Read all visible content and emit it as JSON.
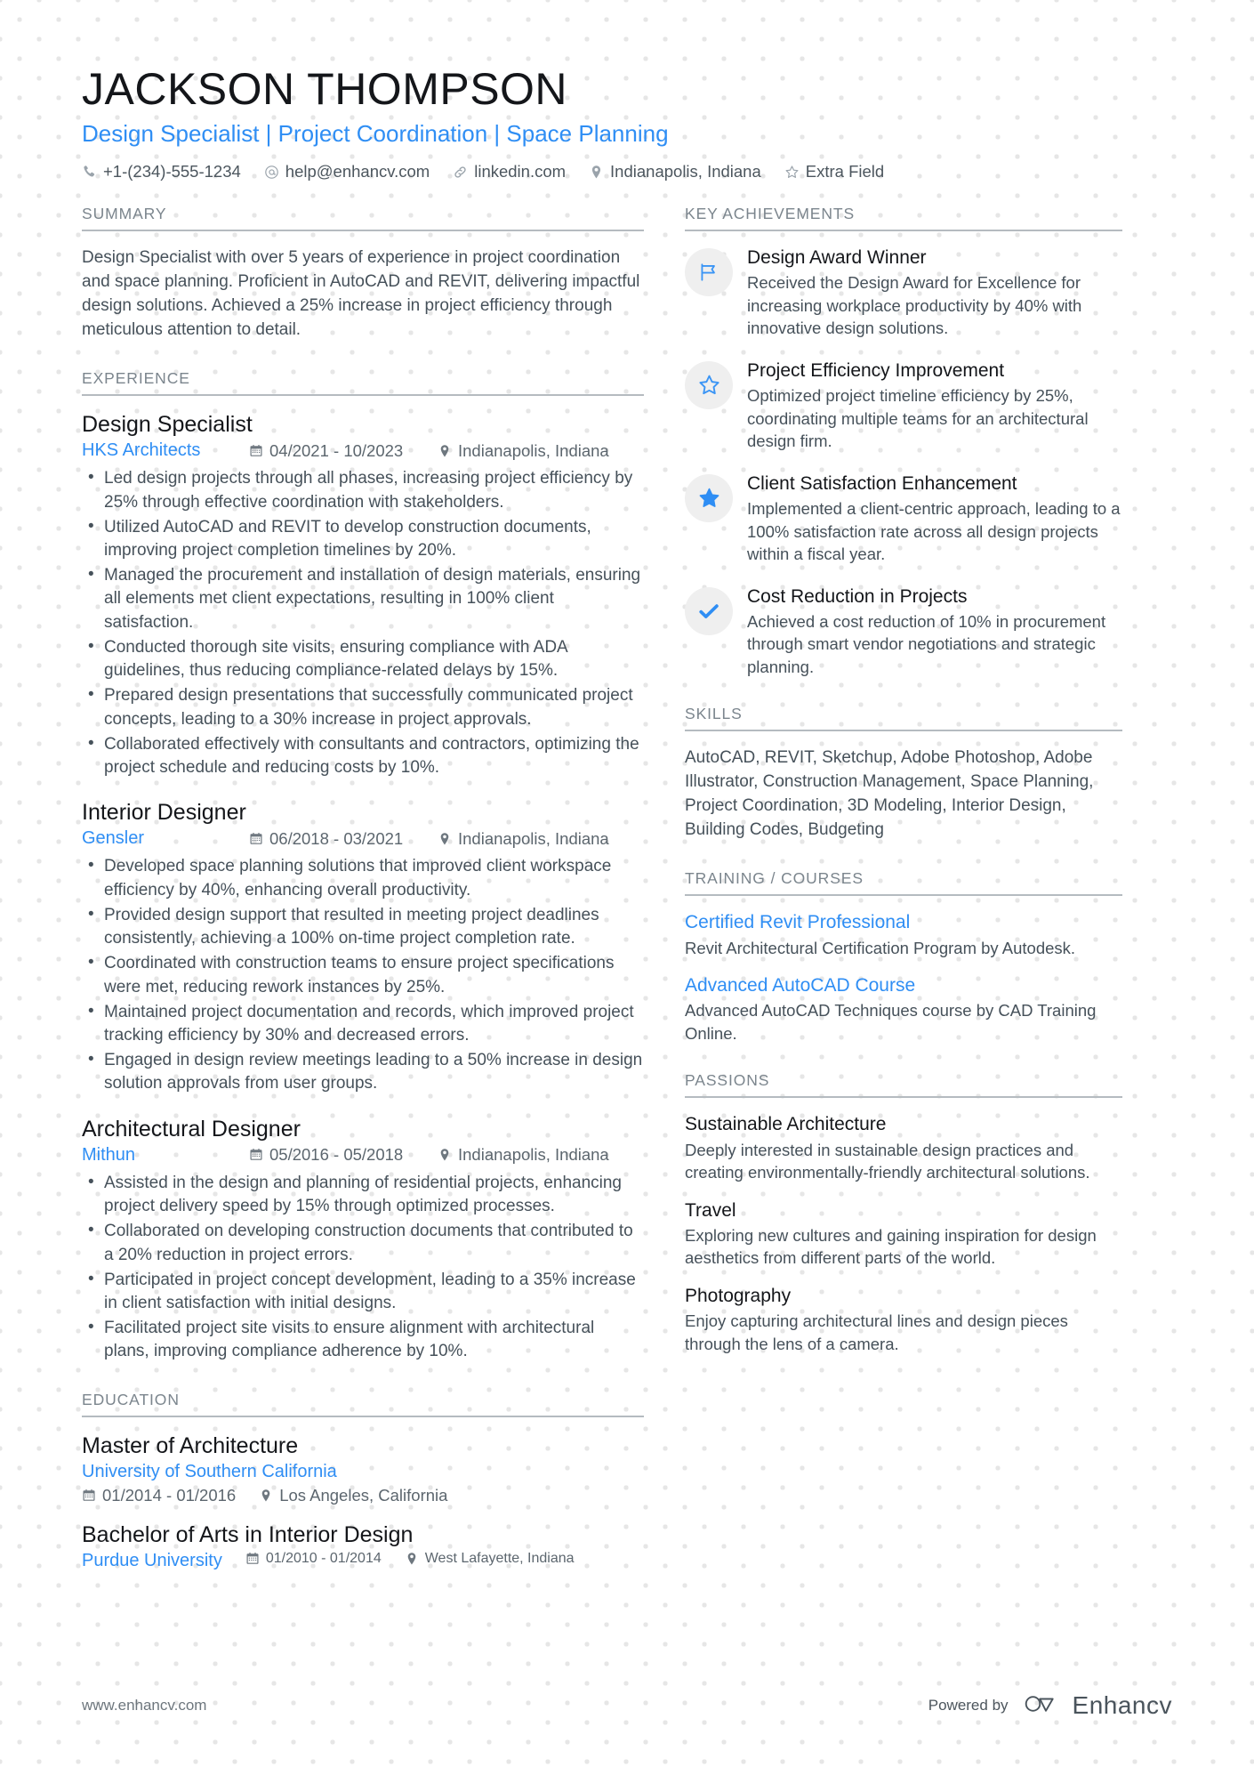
{
  "header": {
    "name": "JACKSON THOMPSON",
    "headline": "Design Specialist | Project Coordination | Space Planning",
    "contacts": [
      {
        "icon": "phone-icon",
        "text": "+1-(234)-555-1234"
      },
      {
        "icon": "email-icon",
        "text": "help@enhancv.com"
      },
      {
        "icon": "link-icon",
        "text": "linkedin.com"
      },
      {
        "icon": "location-icon",
        "text": "Indianapolis, Indiana"
      },
      {
        "icon": "star-icon",
        "text": "Extra Field"
      }
    ]
  },
  "sections": {
    "summary_heading": "SUMMARY",
    "experience_heading": "EXPERIENCE",
    "education_heading": "EDUCATION",
    "achievements_heading": "KEY ACHIEVEMENTS",
    "skills_heading": "SKILLS",
    "training_heading": "TRAINING / COURSES",
    "passions_heading": "PASSIONS"
  },
  "summary": {
    "text": "Design Specialist with over 5 years of experience in project coordination and space planning. Proficient in AutoCAD and REVIT, delivering impactful design solutions. Achieved a 25% increase in project efficiency through meticulous attention to detail."
  },
  "experience": [
    {
      "title": "Design Specialist",
      "company": "HKS Architects",
      "dates": "04/2021 - 10/2023",
      "location": "Indianapolis, Indiana",
      "bullets": [
        "Led design projects through all phases, increasing project efficiency by 25% through effective coordination with stakeholders.",
        "Utilized AutoCAD and REVIT to develop construction documents, improving project completion timelines by 20%.",
        "Managed the procurement and installation of design materials, ensuring all elements met client expectations, resulting in 100% client satisfaction.",
        "Conducted thorough site visits, ensuring compliance with ADA guidelines, thus reducing compliance-related delays by 15%.",
        "Prepared design presentations that successfully communicated project concepts, leading to a 30% increase in project approvals.",
        "Collaborated effectively with consultants and contractors, optimizing the project schedule and reducing costs by 10%."
      ]
    },
    {
      "title": "Interior Designer",
      "company": "Gensler",
      "dates": "06/2018 - 03/2021",
      "location": "Indianapolis, Indiana",
      "bullets": [
        "Developed space planning solutions that improved client workspace efficiency by 40%, enhancing overall productivity.",
        "Provided design support that resulted in meeting project deadlines consistently, achieving a 100% on-time project completion rate.",
        "Coordinated with construction teams to ensure project specifications were met, reducing rework instances by 25%.",
        "Maintained project documentation and records, which improved project tracking efficiency by 30% and decreased errors.",
        "Engaged in design review meetings leading to a 50% increase in design solution approvals from user groups."
      ]
    },
    {
      "title": "Architectural Designer",
      "company": "Mithun",
      "dates": "05/2016 - 05/2018",
      "location": "Indianapolis, Indiana",
      "bullets": [
        "Assisted in the design and planning of residential projects, enhancing project delivery speed by 15% through optimized processes.",
        "Collaborated on developing construction documents that contributed to a 20% reduction in project errors.",
        "Participated in project concept development, leading to a 35% increase in client satisfaction with initial designs.",
        "Facilitated project site visits to ensure alignment with architectural plans, improving compliance adherence by 10%."
      ]
    }
  ],
  "education": [
    {
      "degree": "Master of Architecture",
      "school": "University of Southern California",
      "dates": "01/2014 - 01/2016",
      "location": "Los Angeles, California",
      "inline": false
    },
    {
      "degree": "Bachelor of Arts in Interior Design",
      "school": "Purdue University",
      "dates": "01/2010 - 01/2014",
      "location": "West Lafayette, Indiana",
      "inline": true
    }
  ],
  "achievements": [
    {
      "icon": "flag-icon",
      "title": "Design Award Winner",
      "desc": "Received the Design Award for Excellence for increasing workplace productivity by 40% with innovative design solutions."
    },
    {
      "icon": "star-outline-icon",
      "title": "Project Efficiency Improvement",
      "desc": "Optimized project timeline efficiency by 25%, coordinating multiple teams for an architectural design firm."
    },
    {
      "icon": "star-filled-icon",
      "title": "Client Satisfaction Enhancement",
      "desc": "Implemented a client-centric approach, leading to a 100% satisfaction rate across all design projects within a fiscal year."
    },
    {
      "icon": "check-icon",
      "title": "Cost Reduction in Projects",
      "desc": "Achieved a cost reduction of 10% in procurement through smart vendor negotiations and strategic planning."
    }
  ],
  "skills": {
    "text": "AutoCAD, REVIT, Sketchup, Adobe Photoshop, Adobe Illustrator, Construction Management, Space Planning, Project Coordination, 3D Modeling, Interior Design, Building Codes, Budgeting"
  },
  "training": [
    {
      "title": "Certified Revit Professional",
      "desc": "Revit Architectural Certification Program by Autodesk."
    },
    {
      "title": "Advanced AutoCAD Course",
      "desc": "Advanced AutoCAD Techniques course by CAD Training Online."
    }
  ],
  "passions": [
    {
      "title": "Sustainable Architecture",
      "desc": "Deeply interested in sustainable design practices and creating environmentally-friendly architectural solutions."
    },
    {
      "title": "Travel",
      "desc": "Exploring new cultures and gaining inspiration for design aesthetics from different parts of the world."
    },
    {
      "title": "Photography",
      "desc": "Enjoy capturing architectural lines and design pieces through the lens of a camera."
    }
  ],
  "footer": {
    "url": "www.enhancv.com",
    "powered_by": "Powered by",
    "brand": "Enhancv",
    "brand_icon": "enhancv-logo-icon"
  },
  "colors": {
    "accent": "#2f8ef4",
    "text": "#46515a",
    "heading": "#7b858d",
    "dark": "#14161a"
  }
}
